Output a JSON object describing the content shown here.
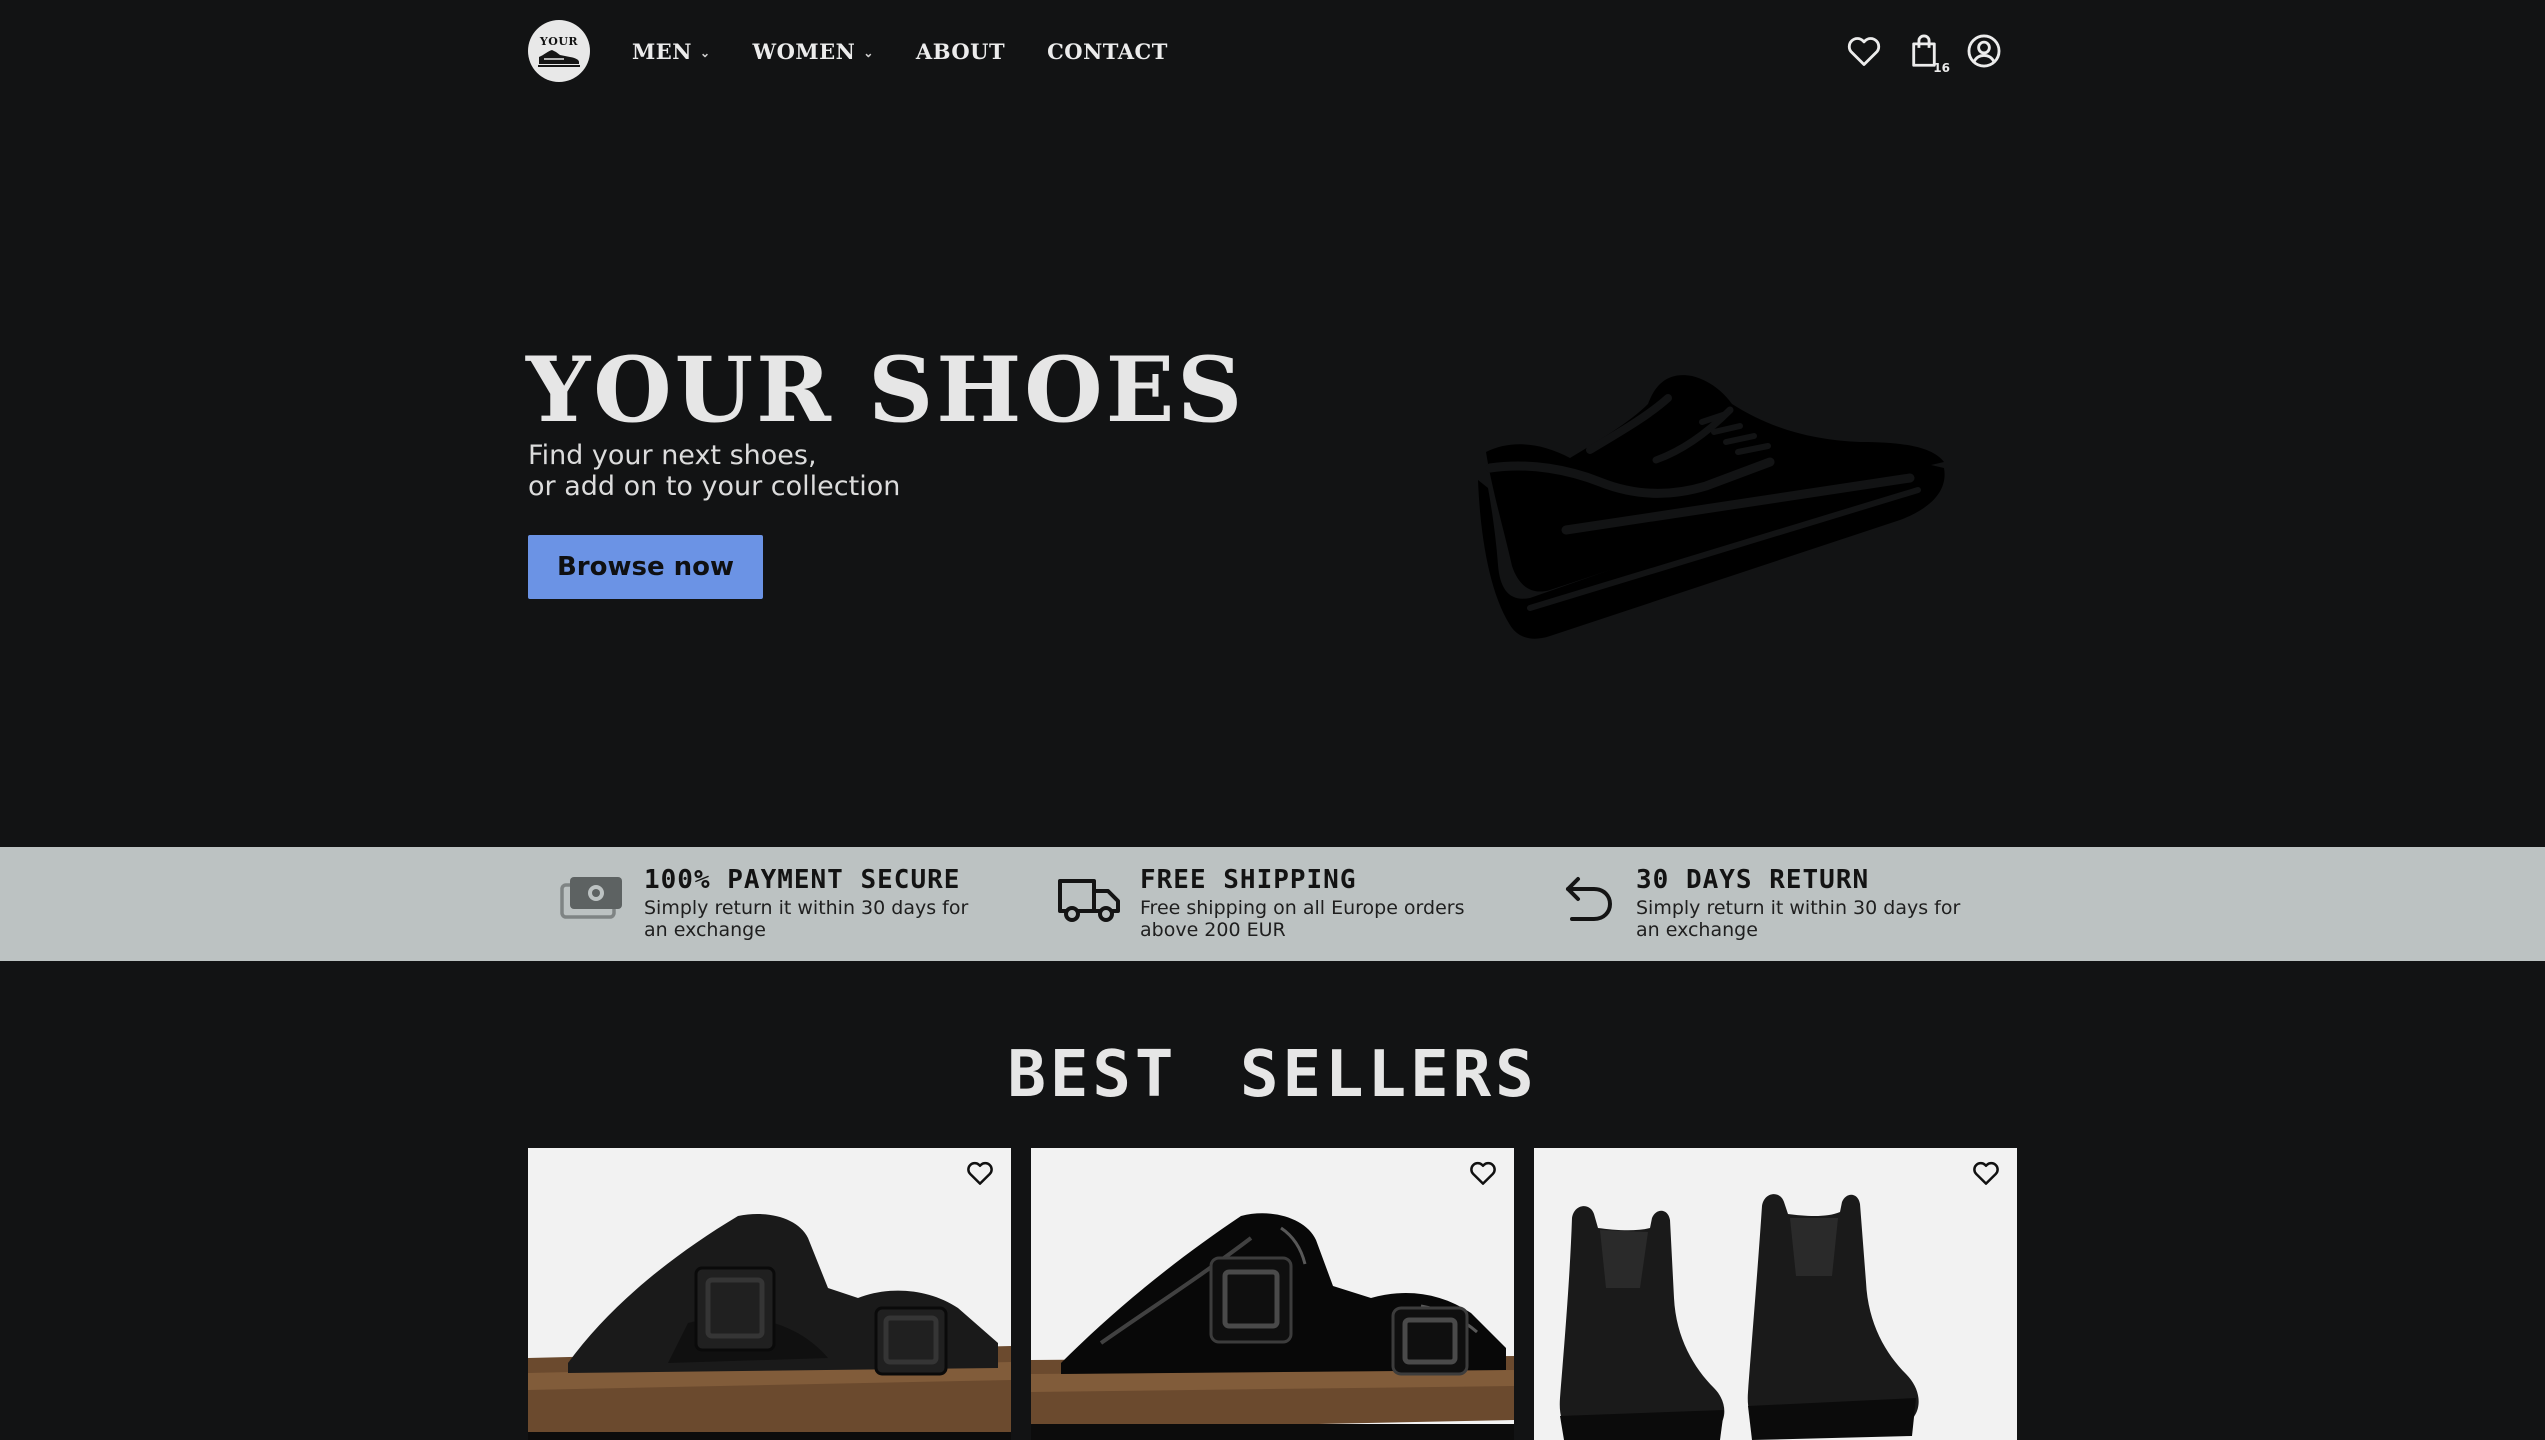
{
  "header": {
    "logo_text": "YOUR",
    "nav": [
      {
        "label": "MEN",
        "has_dropdown": true
      },
      {
        "label": "WOMEN",
        "has_dropdown": true
      },
      {
        "label": "ABOUT",
        "has_dropdown": false
      },
      {
        "label": "CONTACT",
        "has_dropdown": false
      }
    ],
    "dropdown_glyph": "⌄",
    "cart_count": "16",
    "icons": [
      "heart-icon",
      "shopping-bag-icon",
      "user-account-icon"
    ]
  },
  "hero": {
    "title": "YOUR SHOES",
    "subtitle_line1": "Find your next shoes,",
    "subtitle_line2": "or add on to your collection",
    "button_label": "Browse now",
    "accent_color": "#6b93e5",
    "image_icon": "sneaker-icon"
  },
  "features": [
    {
      "icon": "cash-icon",
      "title": "100% PAYMENT SECURE",
      "description": "Simply return it within 30 days for an exchange"
    },
    {
      "icon": "delivery-truck-icon",
      "title": "FREE SHIPPING",
      "description": "Free shipping on all Europe orders above 200 EUR"
    },
    {
      "icon": "return-arrow-icon",
      "title": "30 DAYS RETURN",
      "description": "Simply return it within 30 days for an exchange"
    }
  ],
  "best_sellers": {
    "title": "BEST SELLERS",
    "products": [
      {
        "image": "black-matte-sandal",
        "favorite_icon": "heart-outline-icon"
      },
      {
        "image": "black-patent-sandal",
        "favorite_icon": "heart-outline-icon"
      },
      {
        "image": "black-chelsea-boots",
        "favorite_icon": "heart-outline-icon"
      }
    ]
  },
  "colors": {
    "background": "#121314",
    "feature_bar": "#bcc2c2",
    "text_light": "#e6e6e6",
    "card_bg": "#f2f2f2"
  }
}
